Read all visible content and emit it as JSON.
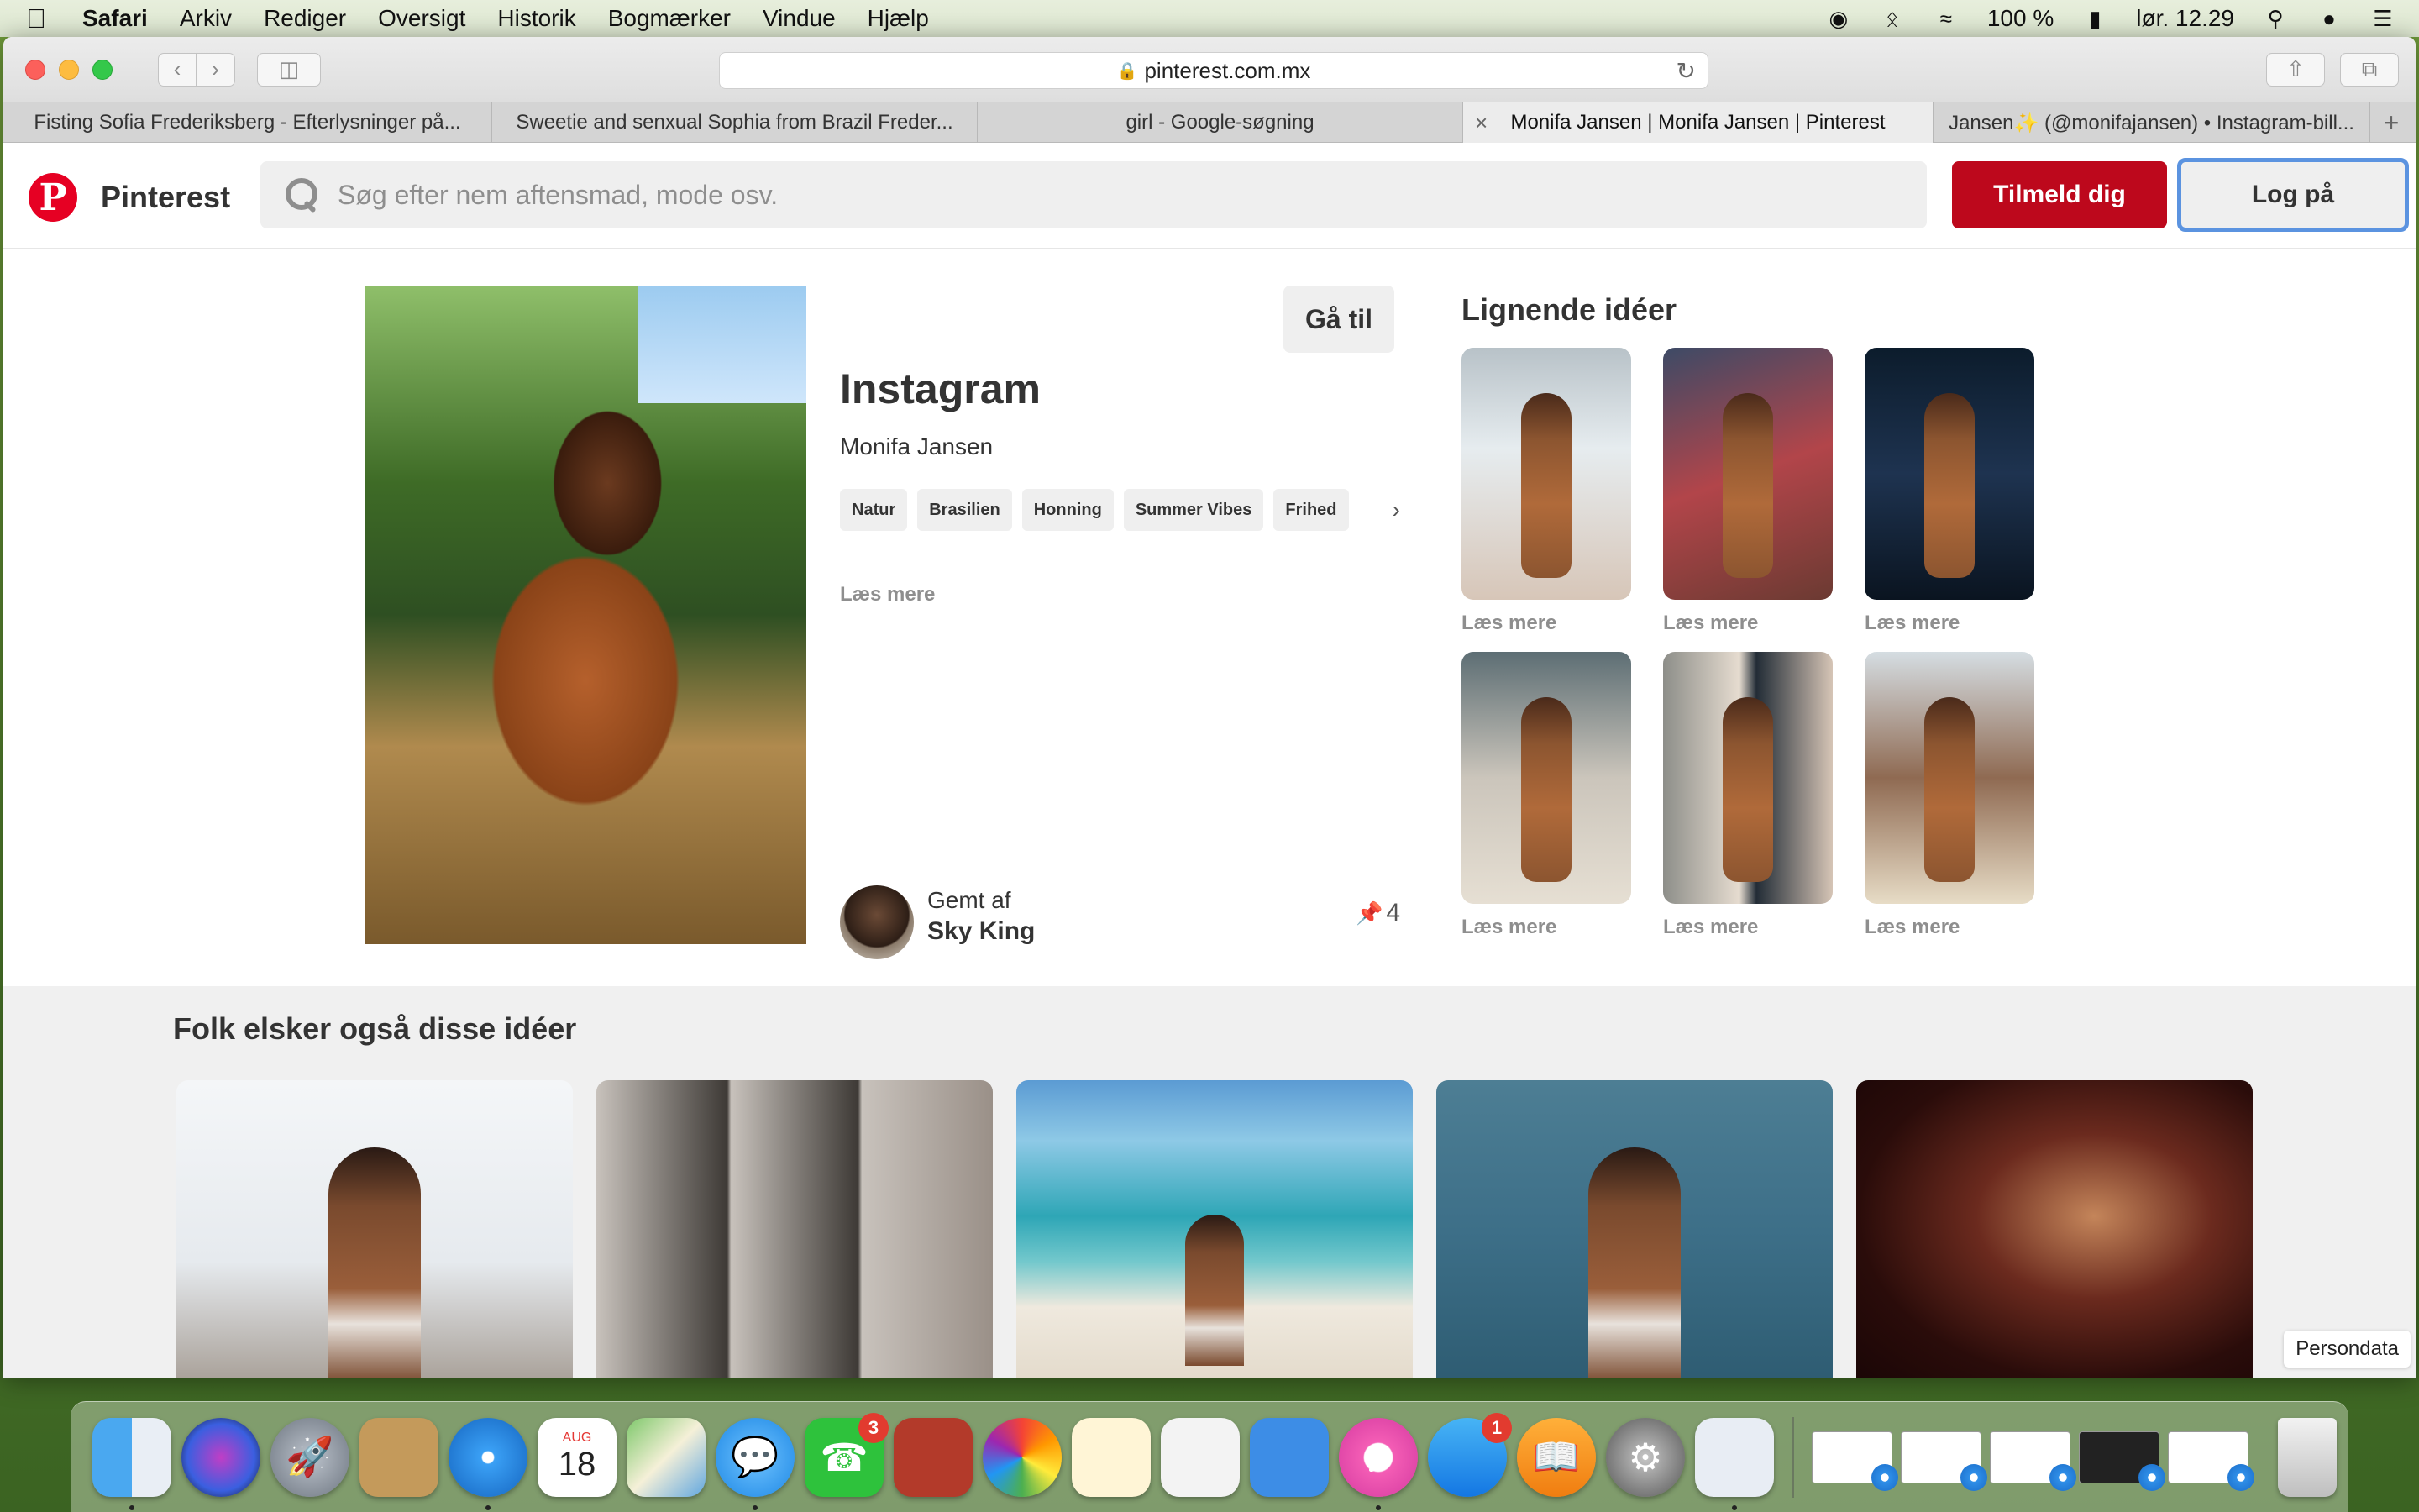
{
  "menubar": {
    "app": "Safari",
    "items": [
      "Arkiv",
      "Rediger",
      "Oversigt",
      "Historik",
      "Bogmærker",
      "Vindue",
      "Hjælp"
    ],
    "battery": "100 %",
    "clock": "lør. 12.29"
  },
  "browser": {
    "url": "pinterest.com.mx",
    "tabs": [
      {
        "title": "Fisting Sofia Frederiksberg - Efterlysninger på..."
      },
      {
        "title": "Sweetie and senxual Sophia from Brazil Freder..."
      },
      {
        "title": "girl - Google-søgning"
      },
      {
        "title": "Monifa Jansen | Monifa Jansen | Pinterest"
      },
      {
        "title": "Jansen✨ (@monifajansen) • Instagram-bill..."
      }
    ],
    "active_tab": 3
  },
  "pinterest": {
    "brand": "Pinterest",
    "logo_letter": "P",
    "search_placeholder": "Søg efter nem aftensmad, mode osv.",
    "signup_label": "Tilmeld dig",
    "login_label": "Log på",
    "accent": "#bd081c"
  },
  "pin": {
    "goto_label": "Gå til",
    "title": "Instagram",
    "author": "Monifa Jansen",
    "tags": [
      "Natur",
      "Brasilien",
      "Honning",
      "Summer Vibes",
      "Frihed"
    ],
    "read_more": "Læs mere",
    "saved_by_label": "Gemt af",
    "saved_by_name": "Sky King",
    "save_count": "4"
  },
  "similar": {
    "title": "Lignende idéer",
    "items": [
      {
        "label": "Læs mere"
      },
      {
        "label": "Læs mere"
      },
      {
        "label": "Læs mere"
      },
      {
        "label": "Læs mere"
      },
      {
        "label": "Læs mere"
      },
      {
        "label": "Læs mere"
      }
    ]
  },
  "also": {
    "title": "Folk elsker også disse idéer"
  },
  "persondata": "Persondata",
  "dock": {
    "badges": {
      "facetime": "3",
      "appstore": "1"
    },
    "calendar_month": "AUG",
    "calendar_day": "18"
  }
}
